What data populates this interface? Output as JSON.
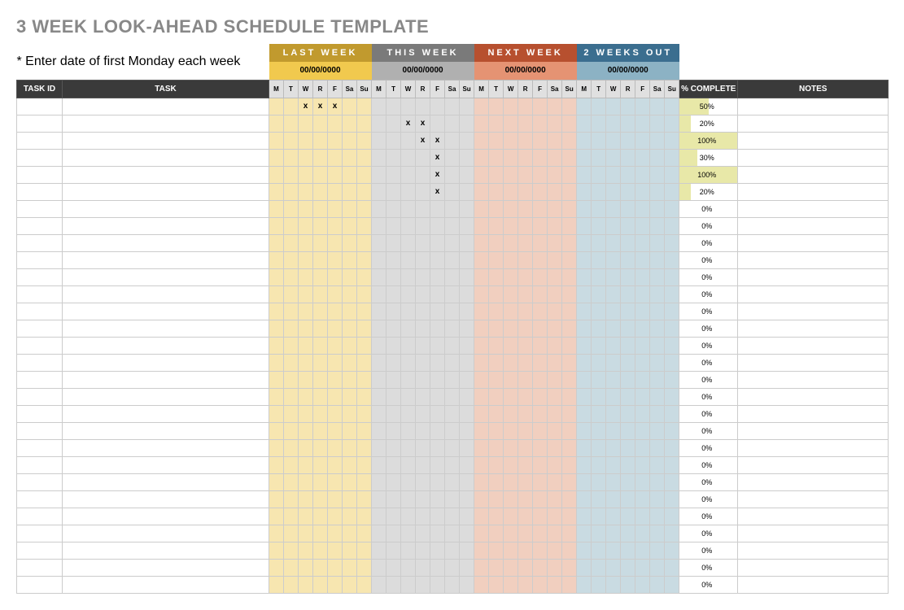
{
  "title": "3 WEEK LOOK-AHEAD SCHEDULE TEMPLATE",
  "instruction": "* Enter date of first Monday each week",
  "weeks": [
    {
      "label": "LAST WEEK",
      "date": "00/00/0000",
      "classH": "wk-last-h",
      "classD": "wk-last-d",
      "classC": "wk-last-c"
    },
    {
      "label": "THIS WEEK",
      "date": "00/00/0000",
      "classH": "wk-this-h",
      "classD": "wk-this-d",
      "classC": "wk-this-c"
    },
    {
      "label": "NEXT WEEK",
      "date": "00/00/0000",
      "classH": "wk-next-h",
      "classD": "wk-next-d",
      "classC": "wk-next-c"
    },
    {
      "label": "2 WEEKS OUT",
      "date": "00/00/0000",
      "classH": "wk-out-h",
      "classD": "wk-out-d",
      "classC": "wk-out-c"
    }
  ],
  "days": [
    "M",
    "T",
    "W",
    "R",
    "F",
    "Sa",
    "Su"
  ],
  "columns": {
    "task_id": "TASK ID",
    "task": "TASK",
    "pct": "% COMPLETE",
    "notes": "NOTES"
  },
  "mark": "x",
  "rows": [
    {
      "marks": [
        2,
        3,
        4
      ],
      "pct": 50
    },
    {
      "marks": [
        9,
        10
      ],
      "pct": 20
    },
    {
      "marks": [
        10,
        11
      ],
      "pct": 100
    },
    {
      "marks": [
        11
      ],
      "pct": 30
    },
    {
      "marks": [
        11
      ],
      "pct": 100
    },
    {
      "marks": [
        11
      ],
      "pct": 20
    },
    {
      "marks": [],
      "pct": 0
    },
    {
      "marks": [],
      "pct": 0
    },
    {
      "marks": [],
      "pct": 0
    },
    {
      "marks": [],
      "pct": 0
    },
    {
      "marks": [],
      "pct": 0
    },
    {
      "marks": [],
      "pct": 0
    },
    {
      "marks": [],
      "pct": 0
    },
    {
      "marks": [],
      "pct": 0
    },
    {
      "marks": [],
      "pct": 0
    },
    {
      "marks": [],
      "pct": 0
    },
    {
      "marks": [],
      "pct": 0
    },
    {
      "marks": [],
      "pct": 0
    },
    {
      "marks": [],
      "pct": 0
    },
    {
      "marks": [],
      "pct": 0
    },
    {
      "marks": [],
      "pct": 0
    },
    {
      "marks": [],
      "pct": 0
    },
    {
      "marks": [],
      "pct": 0
    },
    {
      "marks": [],
      "pct": 0
    },
    {
      "marks": [],
      "pct": 0
    },
    {
      "marks": [],
      "pct": 0
    },
    {
      "marks": [],
      "pct": 0
    },
    {
      "marks": [],
      "pct": 0
    },
    {
      "marks": [],
      "pct": 0
    }
  ]
}
